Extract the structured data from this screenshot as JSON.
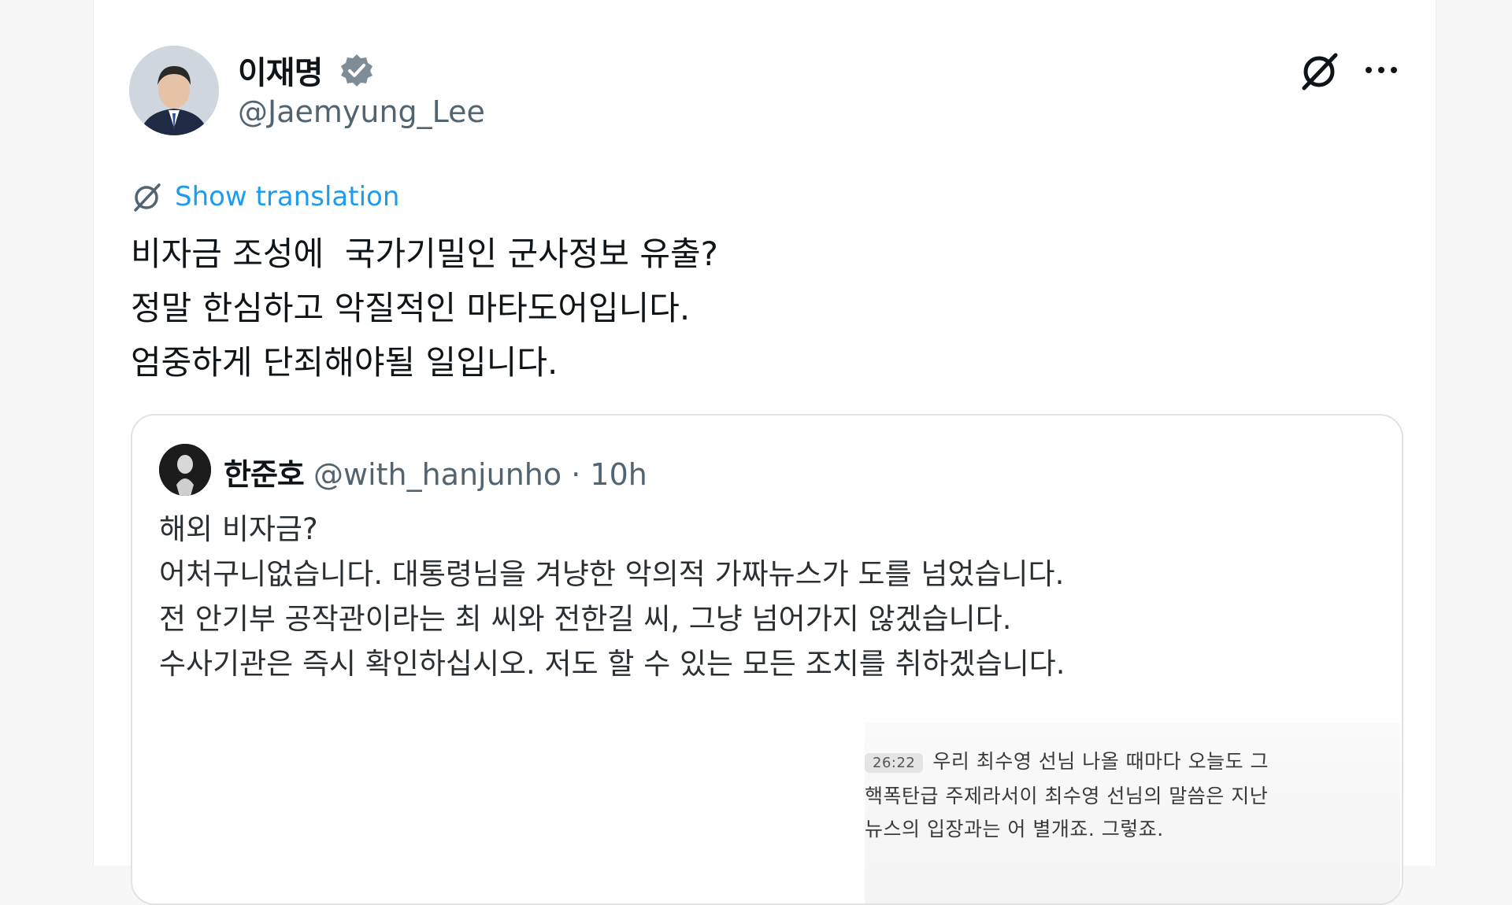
{
  "post": {
    "author_name": "이재명",
    "author_handle": "@Jaemyung_Lee",
    "translate_label": "Show translation",
    "text_lines": [
      "비자금 조성에  국가기밀인 군사정보 유출?",
      "정말 한심하고 악질적인 마타도어입니다.",
      "엄중하게 단죄해야될 일입니다."
    ],
    "more_label": "···"
  },
  "quote": {
    "author_name": "한준호",
    "author_handle": "@with_hanjunho",
    "separator": "·",
    "time": "10h",
    "text_lines": [
      "해외 비자금?",
      "어처구니없습니다. 대통령님을 겨냥한 악의적 가짜뉴스가 도를 넘었습니다.",
      "전 안기부 공작관이라는 최 씨와 전한길 씨, 그냥 넘어가지 않겠습니다.",
      "수사기관은 즉시 확인하십시오. 저도 할 수 있는 모든 조치를 취하겠습니다."
    ],
    "media": {
      "timestamp": "26:22",
      "caption_lines": [
        "우리 최수영 선님 나올 때마다 오늘도 그",
        "핵폭탄급 주제라서이 최수영 선님의 말씀은 지난",
        "뉴스의 입장과는 어 별개죠. 그렇죠."
      ]
    }
  },
  "icons": {
    "verified": "verified-badge-icon",
    "grok": "grok-icon",
    "more": "more-options-icon",
    "translate": "translate-icon"
  },
  "colors": {
    "link": "#1d9bf0",
    "verified": "#7e8c97",
    "secondary_text": "#536471"
  }
}
